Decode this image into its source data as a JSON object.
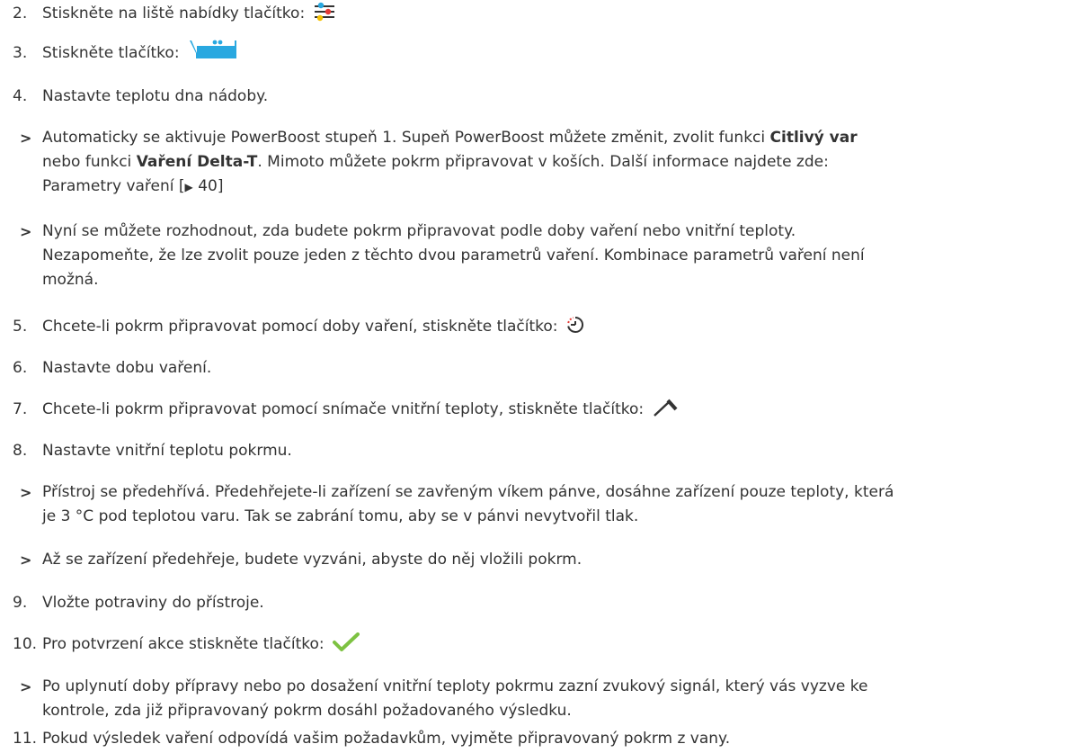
{
  "arrow_marker": ">",
  "steps": [
    {
      "num": "2.",
      "text": "Stiskněte na liště nabídky tlačítko:"
    },
    {
      "num": "3.",
      "text": "Stiskněte tlačítko:"
    },
    {
      "num": "4.",
      "text": "Nastavte teplotu dna nádoby."
    },
    {
      "num": "5.",
      "text": "Chcete-li pokrm připravovat pomocí doby vaření, stiskněte tlačítko:"
    },
    {
      "num": "6.",
      "text": "Nastavte dobu vaření."
    },
    {
      "num": "7.",
      "text": "Chcete-li pokrm připravovat pomocí snímače vnitřní teploty, stiskněte tlačítko:"
    },
    {
      "num": "8.",
      "text": "Nastavte vnitřní teplotu pokrmu."
    },
    {
      "num": "9.",
      "text": "Vložte potraviny do přístroje."
    },
    {
      "num": "10.",
      "text": "Pro potvrzení akce stiskněte tlačítko:"
    },
    {
      "num": "11.",
      "text": "Pokud výsledek vaření odpovídá vašim požadavkům, vyjměte připravovaný pokrm z vany."
    }
  ],
  "results": {
    "r1": {
      "l1_a": "Automaticky se aktivuje PowerBoost stupeň 1. Supeň PowerBoost můžete změnit, zvolit funkci ",
      "l1_b": "Citlivý var",
      "l2_a": "nebo funkci ",
      "l2_b": "Vaření Delta-T",
      "l2_c": ". Mimoto můžete pokrm připravovat v koších. Další informace najdete zde:",
      "l3_a": "Parametry vaření [",
      "l3_b": "40]"
    },
    "r2": {
      "l1": "Nyní se můžete rozhodnout, zda budete pokrm připravovat podle doby vaření nebo vnitřní teploty.",
      "l2": "Nezapomeňte, že lze zvolit pouze jeden z těchto dvou parametrů vaření. Kombinace parametrů vaření není",
      "l3": "možná."
    },
    "r3": {
      "l1": "Přístroj se předehřívá. Předehřejete-li zařízení se zavřeným víkem pánve, dosáhne zařízení pouze teploty, která",
      "l2": "je 3 °C pod teplotou varu. Tak se zabrání tomu, aby se v pánvi nevytvořil tlak."
    },
    "r4": {
      "l1": "Až se zařízení předehřeje, budete vyzváni, abyste do něj vložili pokrm."
    },
    "r5": {
      "l1": "Po uplynutí doby přípravy nebo po dosažení vnitřní teploty pokrmu zazní zvukový signál, který vás vyzve ke",
      "l2": "kontrole, zda již připravovaný pokrm dosáhl požadovaného výsledku."
    }
  },
  "icons": {
    "menu_settings": "settings-menu-icon",
    "vat_mode": "vat-mode-icon",
    "cooking_time": "timer-icon",
    "core_probe": "core-temperature-probe-icon",
    "confirm": "checkmark-icon",
    "link_arrow": "triangle-right-icon"
  },
  "colors": {
    "text": "#333333",
    "check": "#7dc242",
    "vat": "#29a8e0",
    "timer_red": "#e53935",
    "menu_yellow": "#f6c100",
    "menu_blue": "#29a8e0"
  }
}
